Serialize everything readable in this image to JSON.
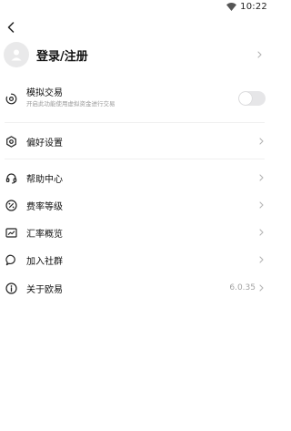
{
  "status_bar": {
    "time": "10:22"
  },
  "header": {
    "back_icon": "chevron-left-icon"
  },
  "account": {
    "label": "登录/注册",
    "avatar_icon": "user-avatar-icon"
  },
  "simulated_trading": {
    "title": "模拟交易",
    "subtitle": "开启此功能使用虚拟资金进行交易",
    "enabled": false,
    "icon": "simulation-icon"
  },
  "menu": {
    "preferences": {
      "label": "偏好设置",
      "icon": "gear-icon"
    },
    "help": {
      "label": "帮助中心",
      "icon": "headset-icon"
    },
    "fees": {
      "label": "费率等级",
      "icon": "percent-icon"
    },
    "rates": {
      "label": "汇率概览",
      "icon": "exchange-chart-icon"
    },
    "community": {
      "label": "加入社群",
      "icon": "chat-icon"
    },
    "about": {
      "label": "关于欧易",
      "value": "6.0.35",
      "icon": "info-icon"
    }
  },
  "colors": {
    "text": "#111111",
    "muted": "#9a9a9a",
    "chevron": "#b5b5b5",
    "divider": "#f0f0f0",
    "toggle_off": "#e6e6e8"
  }
}
